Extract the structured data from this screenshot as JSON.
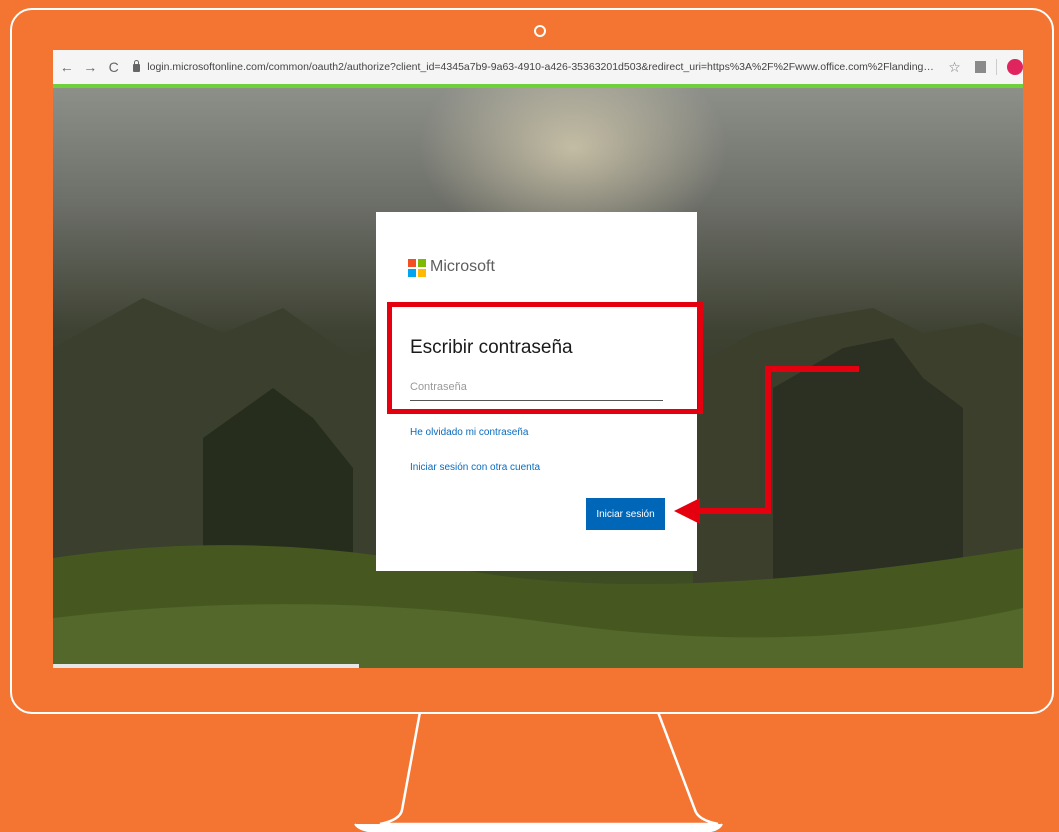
{
  "browser": {
    "url": "login.microsoftonline.com/common/oauth2/authorize?client_id=4345a7b9-9a63-4910-a426-35363201d503&redirect_uri=https%3A%2F%2Fwww.office.com%2Flanding&r...",
    "back_icon": "←",
    "forward_icon": "→",
    "reload_icon": "C",
    "star_icon": "☆",
    "loading_bar_color": "#6ed03a"
  },
  "login": {
    "brand": "Microsoft",
    "email": "",
    "heading": "Escribir contraseña",
    "password_placeholder": "Contraseña",
    "password_value": "",
    "forgot_link": "He olvidado mi contraseña",
    "other_account_link": "Iniciar sesión con otra cuenta",
    "signin_button": "Iniciar sesión",
    "button_color": "#0067b8",
    "logo_colors": [
      "#f25022",
      "#7fba00",
      "#00a4ef",
      "#ffb900"
    ]
  },
  "theme": {
    "background": "#f47432",
    "annotation_color": "#e4000f"
  }
}
